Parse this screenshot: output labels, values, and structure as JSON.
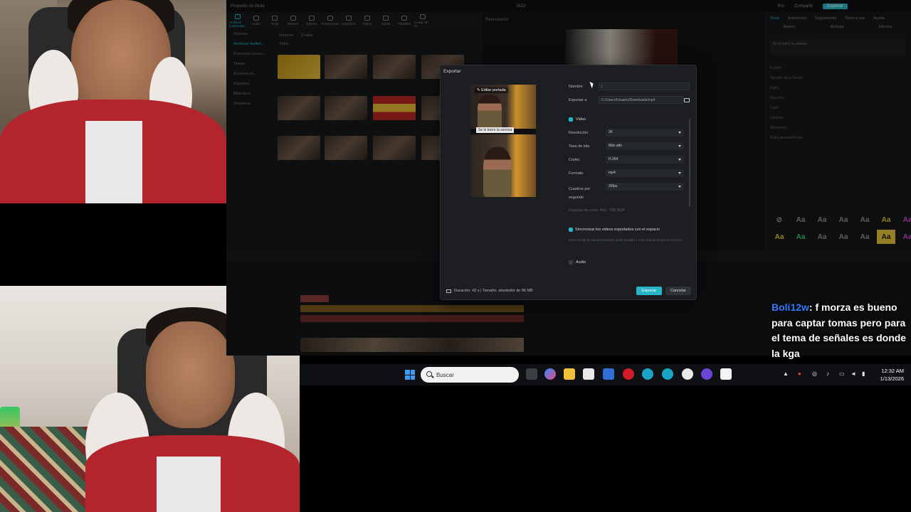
{
  "editor": {
    "title": "Proyecto sin título",
    "time": "0112",
    "tools": [
      "Archivos multimedia",
      "Audio",
      "Texto",
      "Stickers",
      "Efectos",
      "Transiciones",
      "Subtítulos",
      "Filtros",
      "Ajuste",
      "Plantillas",
      "Avatar de IA"
    ],
    "sidebar": [
      "Importar",
      "Archivos multim...",
      "Proyectos secun...",
      "Temas",
      "Archivos en...",
      "Espacios",
      "Biblioteca",
      "Dreamina"
    ],
    "media_header": [
      "Importar",
      "Grabar"
    ],
    "media_filter": "Todos",
    "player_title": "Reproductor",
    "inspector_tabs": [
      "Texto",
      "Animación",
      "Seguimiento",
      "Texto a voz",
      "Ayuda"
    ],
    "inspector_subtabs": [
      "Básico",
      "Burbuja",
      "Efectos"
    ],
    "inspector_text": "Se le borro la sonrisa",
    "inspector_rows": [
      "Fuente",
      "Tamaño de la fuente",
      "Estilo",
      "May./min.",
      "Color",
      "Carácter",
      "Alineación",
      "Estilo preestablecido"
    ],
    "header_right": [
      "Pro",
      "Compartir",
      "Exportar"
    ]
  },
  "dialog": {
    "title": "Exportar",
    "edit_cover": "Editar portada",
    "cover_caption": "Se le borro la sonrisa",
    "name_label": "Nombre",
    "name_value": "|",
    "export_to_label": "Exportar a",
    "export_to_value": "C:/Users/Usuario/Downloads/mp4",
    "video_label": "Video",
    "resolution_label": "Resolución",
    "resolution_value": "2K",
    "bitrate_label": "Tasa de bits",
    "bitrate_value": "Más alto",
    "codec_label": "Codec",
    "codec_value": "H.264",
    "format_label": "Formato",
    "format_value": "mp4",
    "fps_label": "Cuadros por segundo",
    "fps_value": "30fps",
    "color_space_note": "Espacio de color: Rec. 709 SDR",
    "sync_label": "Sincronizar los videos exportados con el espacio",
    "sync_note": "Obtén 5 GB de almacenamiento gratis durante 1 mes cuando actives la función.",
    "audio_label": "Audio",
    "footer_info": "Duración: 42 s | Tamaño: alrededor de 86 MB",
    "export_button": "Exportar",
    "cancel_button": "Cancelar"
  },
  "taskbar": {
    "search_placeholder": "Buscar",
    "time": "12:32 AM",
    "date": "1/13/2026"
  },
  "chat": {
    "user": "Boli12w",
    "separator": ": ",
    "message": "f morza es bueno para captar tomas pero para el tema de señales es donde la kga"
  },
  "colors": {
    "accent": "#28b5c7",
    "chat_user": "#2f80ff",
    "jacket_red": "#b3242c"
  }
}
